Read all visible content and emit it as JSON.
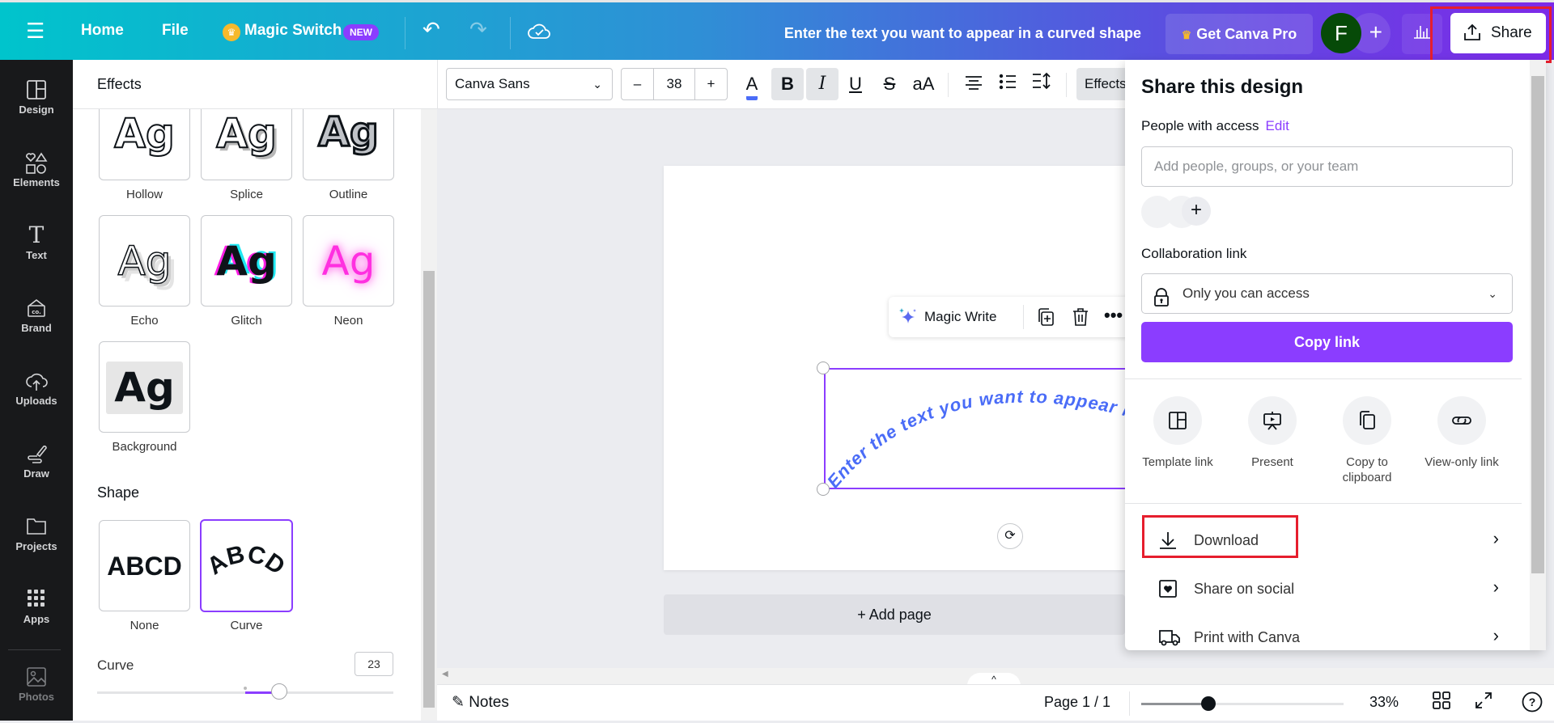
{
  "topbar": {
    "menu_icon": "hamburger-icon",
    "home": "Home",
    "file": "File",
    "magic_switch": "Magic Switch",
    "new_badge": "NEW",
    "undo_icon": "undo-icon",
    "redo_icon": "redo-icon",
    "save_status_icon": "cloud-check-icon",
    "doc_title": "Enter the text you want to appear in a curved shape",
    "get_pro": "Get Canva Pro",
    "avatar_initial": "F",
    "avatar_color": "#064a08",
    "share": "Share"
  },
  "rail": {
    "items": [
      {
        "label": "Design",
        "icon": "layout-icon"
      },
      {
        "label": "Elements",
        "icon": "shapes-icon"
      },
      {
        "label": "Text",
        "icon": "text-icon"
      },
      {
        "label": "Brand",
        "icon": "brand-icon"
      },
      {
        "label": "Uploads",
        "icon": "cloud-upload-icon"
      },
      {
        "label": "Draw",
        "icon": "pen-icon"
      },
      {
        "label": "Projects",
        "icon": "folder-icon"
      },
      {
        "label": "Apps",
        "icon": "grid-icon"
      },
      {
        "label": "Photos",
        "icon": "image-icon"
      }
    ]
  },
  "panel": {
    "title": "Effects",
    "effects": [
      {
        "label": "Hollow",
        "sample": "Ag"
      },
      {
        "label": "Splice",
        "sample": "Ag"
      },
      {
        "label": "Outline",
        "sample": "Ag"
      },
      {
        "label": "Echo",
        "sample": "Ag"
      },
      {
        "label": "Glitch",
        "sample": "Ag"
      },
      {
        "label": "Neon",
        "sample": "Ag"
      },
      {
        "label": "Background",
        "sample": "Ag"
      }
    ],
    "shape_title": "Shape",
    "shapes": [
      {
        "label": "None",
        "sample": "ABCD",
        "selected": false
      },
      {
        "label": "Curve",
        "sample": "ABCD",
        "selected": true
      }
    ],
    "curve_label": "Curve",
    "curve_value": "23",
    "curve_slider": {
      "min": -100,
      "max": 100,
      "value": 23
    }
  },
  "format_toolbar": {
    "font": "Canva Sans",
    "size": "38",
    "minus": "–",
    "plus": "+",
    "effects": "Effects",
    "text_color": "#4a6cf7",
    "bold_active": true,
    "italic_active": true
  },
  "canvas": {
    "curved_text": "Enter the text you want to appear in a curved shape",
    "text_color": "#4a6cf7",
    "magic_write": "Magic Write",
    "add_page": "+ Add page"
  },
  "bottombar": {
    "notes": "Notes",
    "page": "Page 1 / 1",
    "zoom": "33%",
    "zoom_fraction": 0.33
  },
  "share_panel": {
    "title": "Share this design",
    "people_label": "People with access",
    "edit": "Edit",
    "people_placeholder": "Add people, groups, or your team",
    "collab_label": "Collaboration link",
    "collab_access": "Only you can access",
    "copy_link": "Copy link",
    "quick_actions": [
      {
        "label": "Template link",
        "icon": "template-icon"
      },
      {
        "label": "Present",
        "icon": "present-icon"
      },
      {
        "label": "Copy to clipboard",
        "icon": "copy-icon"
      },
      {
        "label": "View-only link",
        "icon": "link-icon"
      }
    ],
    "rows": [
      {
        "label": "Download",
        "icon": "download-icon"
      },
      {
        "label": "Share on social",
        "icon": "heart-icon"
      },
      {
        "label": "Print with Canva",
        "icon": "truck-icon"
      }
    ]
  },
  "colors": {
    "accent": "#8b3dff",
    "highlight": "#e61e2d"
  }
}
